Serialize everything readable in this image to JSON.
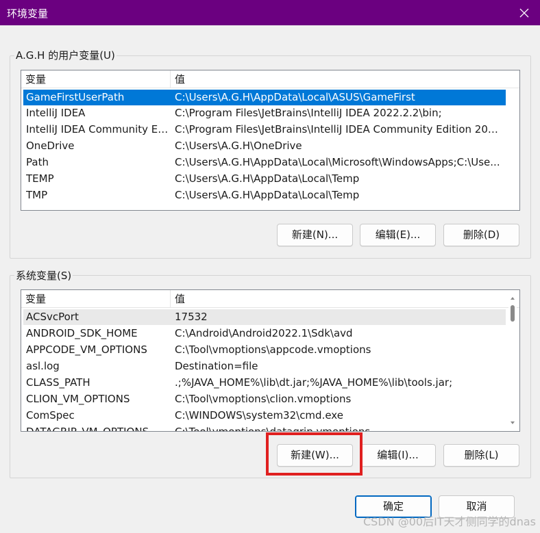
{
  "window": {
    "title": "环境变量"
  },
  "user_vars": {
    "group_label": "A.G.H 的用户变量(U)",
    "columns": [
      "变量",
      "值"
    ],
    "rows": [
      {
        "name": "GameFirstUserPath",
        "value": "C:\\Users\\A.G.H\\AppData\\Local\\ASUS\\GameFirst"
      },
      {
        "name": "IntelliJ IDEA",
        "value": "C:\\Program Files\\JetBrains\\IntelliJ IDEA 2022.2.2\\bin;"
      },
      {
        "name": "IntelliJ IDEA Community Ed...",
        "value": "C:\\Program Files\\JetBrains\\IntelliJ IDEA Community Edition 2022..."
      },
      {
        "name": "OneDrive",
        "value": "C:\\Users\\A.G.H\\OneDrive"
      },
      {
        "name": "Path",
        "value": "C:\\Users\\A.G.H\\AppData\\Local\\Microsoft\\WindowsApps;C:\\Use..."
      },
      {
        "name": "TEMP",
        "value": "C:\\Users\\A.G.H\\AppData\\Local\\Temp"
      },
      {
        "name": "TMP",
        "value": "C:\\Users\\A.G.H\\AppData\\Local\\Temp"
      }
    ],
    "buttons": {
      "new": "新建(N)...",
      "edit": "编辑(E)...",
      "delete": "删除(D)"
    }
  },
  "system_vars": {
    "group_label": "系统变量(S)",
    "columns": [
      "变量",
      "值"
    ],
    "rows": [
      {
        "name": "ACSvcPort",
        "value": "17532"
      },
      {
        "name": "ANDROID_SDK_HOME",
        "value": "C:\\Android\\Android2022.1\\Sdk\\avd"
      },
      {
        "name": "APPCODE_VM_OPTIONS",
        "value": "C:\\Tool\\vmoptions\\appcode.vmoptions"
      },
      {
        "name": "asl.log",
        "value": "Destination=file"
      },
      {
        "name": "CLASS_PATH",
        "value": ".;%JAVA_HOME%\\lib\\dt.jar;%JAVA_HOME%\\lib\\tools.jar;"
      },
      {
        "name": "CLION_VM_OPTIONS",
        "value": "C:\\Tool\\vmoptions\\clion.vmoptions"
      },
      {
        "name": "ComSpec",
        "value": "C:\\WINDOWS\\system32\\cmd.exe"
      },
      {
        "name": "DATAGRIP_VM_OPTIONS",
        "value": "C:\\Tool\\vmoptions\\datagrip.vmoptions"
      }
    ],
    "buttons": {
      "new": "新建(W)...",
      "edit": "编辑(I)...",
      "delete": "删除(L)"
    }
  },
  "footer": {
    "ok": "确定",
    "cancel": "取消"
  },
  "watermark": "CSDN @00后IT天才侧同学的dnas",
  "colors": {
    "titlebar": "#6b0080",
    "selection": "#0078d7",
    "highlight": "#e02020"
  }
}
